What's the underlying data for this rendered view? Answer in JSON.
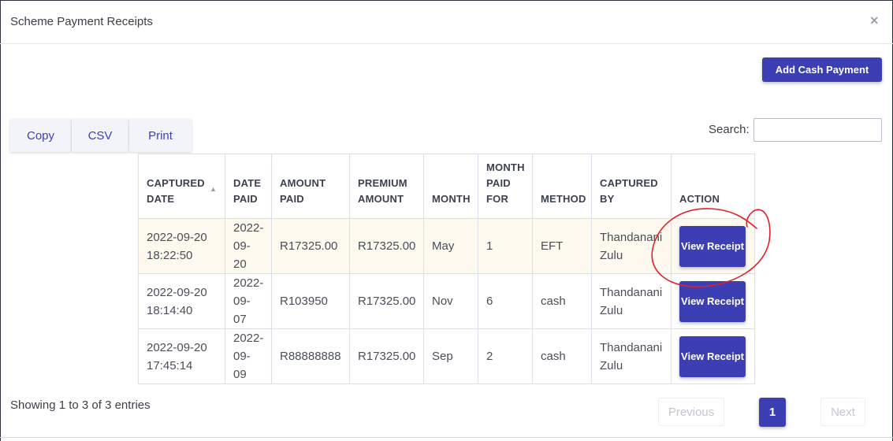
{
  "modal": {
    "title": "Scheme Payment Receipts",
    "close_icon": "×"
  },
  "toolbar": {
    "add_cash_payment_label": "Add Cash Payment"
  },
  "export": {
    "copy_label": "Copy",
    "csv_label": "CSV",
    "print_label": "Print"
  },
  "search": {
    "label": "Search:",
    "value": ""
  },
  "table": {
    "headers": {
      "captured_date": "CAPTURED DATE",
      "date_paid": "DATE PAID",
      "amount_paid": "AMOUNT PAID",
      "premium_amount": "PREMIUM AMOUNT",
      "month": "MONTH",
      "month_paid_for": "MONTH PAID FOR",
      "method": "METHOD",
      "captured_by": "CAPTURED BY",
      "action": "ACTION"
    },
    "sort_indicator": "▲",
    "rows": [
      {
        "captured_date": "2022-09-20 18:22:50",
        "date_paid": "2022-09-20",
        "amount_paid": "R17325.00",
        "premium_amount": "R17325.00",
        "month": "May",
        "month_paid_for": "1",
        "method": "EFT",
        "captured_by": "Thandanani Zulu",
        "action_label": "View Receipt"
      },
      {
        "captured_date": "2022-09-20 18:14:40",
        "date_paid": "2022-09-07",
        "amount_paid": "R103950",
        "premium_amount": "R17325.00",
        "month": "Nov",
        "month_paid_for": "6",
        "method": "cash",
        "captured_by": "Thandanani Zulu",
        "action_label": "View Receipt"
      },
      {
        "captured_date": "2022-09-20 17:45:14",
        "date_paid": "2022-09-09",
        "amount_paid": "R88888888",
        "premium_amount": "R17325.00",
        "month": "Sep",
        "month_paid_for": "2",
        "method": "cash",
        "captured_by": "Thandanani Zulu",
        "action_label": "View Receipt"
      }
    ]
  },
  "footer": {
    "info": "Showing 1 to 3 of 3 entries",
    "previous_label": "Previous",
    "current_page": "1",
    "next_label": "Next"
  },
  "colors": {
    "accent": "#3c3fb3",
    "highlight_row": "#fdf9ef",
    "annotation": "#e0202a"
  }
}
